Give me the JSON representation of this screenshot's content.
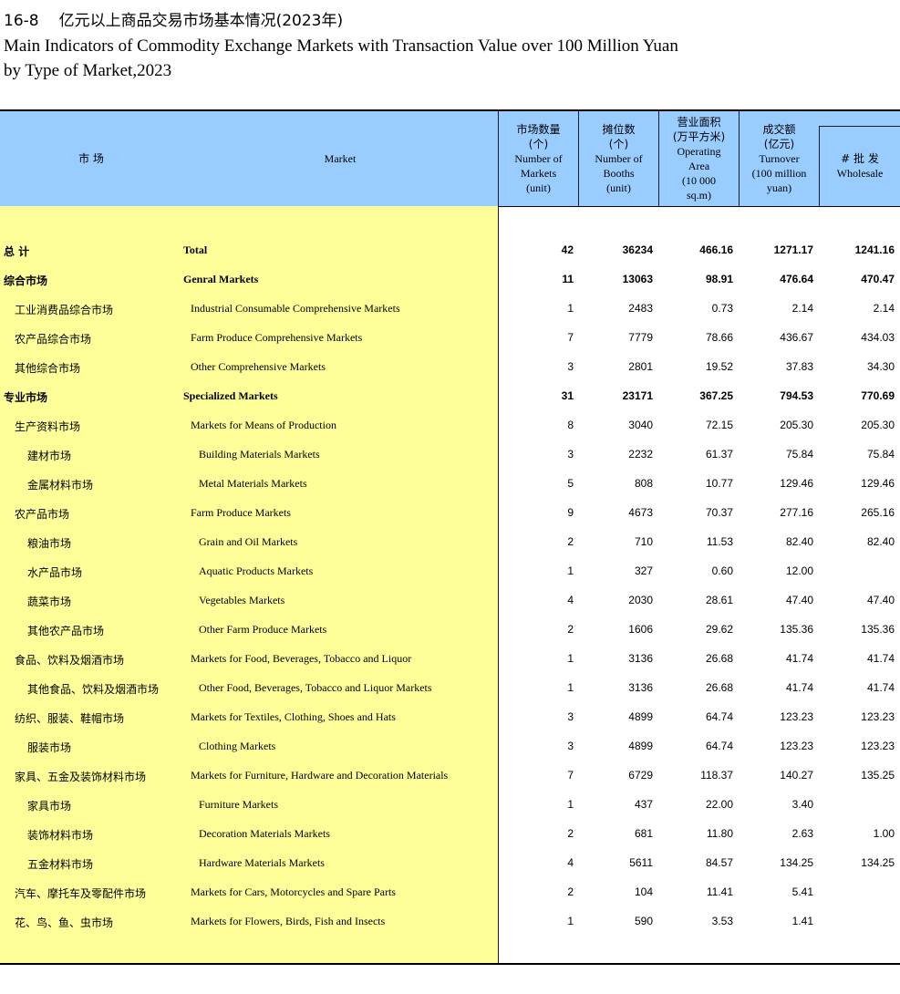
{
  "title": {
    "number": "16-8",
    "cn": "亿元以上商品交易市场基本情况(2023年)",
    "en_line1": "Main Indicators of Commodity Exchange Markets with Transaction Value over 100 Million Yuan",
    "en_line2": "by Type of Market,2023"
  },
  "header": {
    "market_cn": "市  场",
    "market_en": "Market",
    "col_markets": [
      "市场数量",
      "(个)",
      "Number of",
      "Markets",
      "(unit)"
    ],
    "col_booths": [
      "摊位数",
      "(个)",
      "Number of",
      "Booths",
      "(unit)"
    ],
    "col_area": [
      "营业面积",
      "(万平方米)",
      "Operating",
      "Area",
      "(10 000",
      "sq.m)"
    ],
    "col_turnover": [
      "成交额",
      "(亿元)",
      "Turnover",
      "(100 million",
      "yuan)"
    ],
    "col_wholesale": [
      "# 批  发",
      "Wholesale"
    ]
  },
  "rows": [
    {
      "cn": "总      计",
      "en": "Total",
      "markets": "42",
      "booths": "36234",
      "area": "466.16",
      "turnover": "1271.17",
      "wholesale": "1241.16",
      "level": 0
    },
    {
      "cn": "综合市场",
      "en": "Genral Markets",
      "markets": "11",
      "booths": "13063",
      "area": "98.91",
      "turnover": "476.64",
      "wholesale": "470.47",
      "level": 0
    },
    {
      "cn": "工业消费品综合市场",
      "en": "Industrial Consumable Comprehensive Markets",
      "markets": "1",
      "booths": "2483",
      "area": "0.73",
      "turnover": "2.14",
      "wholesale": "2.14",
      "level": 1
    },
    {
      "cn": "农产品综合市场",
      "en": "Farm Produce Comprehensive Markets",
      "markets": "7",
      "booths": "7779",
      "area": "78.66",
      "turnover": "436.67",
      "wholesale": "434.03",
      "level": 1
    },
    {
      "cn": "其他综合市场",
      "en": "Other Comprehensive Markets",
      "markets": "3",
      "booths": "2801",
      "area": "19.52",
      "turnover": "37.83",
      "wholesale": "34.30",
      "level": 1
    },
    {
      "cn": "专业市场",
      "en": "Specialized Markets",
      "markets": "31",
      "booths": "23171",
      "area": "367.25",
      "turnover": "794.53",
      "wholesale": "770.69",
      "level": 0
    },
    {
      "cn": "生产资料市场",
      "en": "Markets for Means of Production",
      "markets": "8",
      "booths": "3040",
      "area": "72.15",
      "turnover": "205.30",
      "wholesale": "205.30",
      "level": 1
    },
    {
      "cn": "建材市场",
      "en": "Building Materials Markets",
      "markets": "3",
      "booths": "2232",
      "area": "61.37",
      "turnover": "75.84",
      "wholesale": "75.84",
      "level": 2
    },
    {
      "cn": "金属材料市场",
      "en": "Metal Materials Markets",
      "markets": "5",
      "booths": "808",
      "area": "10.77",
      "turnover": "129.46",
      "wholesale": "129.46",
      "level": 2
    },
    {
      "cn": "农产品市场",
      "en": "Farm Produce Markets",
      "markets": "9",
      "booths": "4673",
      "area": "70.37",
      "turnover": "277.16",
      "wholesale": "265.16",
      "level": 1
    },
    {
      "cn": "粮油市场",
      "en": "Grain and Oil Markets",
      "markets": "2",
      "booths": "710",
      "area": "11.53",
      "turnover": "82.40",
      "wholesale": "82.40",
      "level": 2
    },
    {
      "cn": "水产品市场",
      "en": "Aquatic Products Markets",
      "markets": "1",
      "booths": "327",
      "area": "0.60",
      "turnover": "12.00",
      "wholesale": "",
      "level": 2
    },
    {
      "cn": "蔬菜市场",
      "en": "Vegetables Markets",
      "markets": "4",
      "booths": "2030",
      "area": "28.61",
      "turnover": "47.40",
      "wholesale": "47.40",
      "level": 2
    },
    {
      "cn": "其他农产品市场",
      "en": "Other Farm Produce Markets",
      "markets": "2",
      "booths": "1606",
      "area": "29.62",
      "turnover": "135.36",
      "wholesale": "135.36",
      "level": 2
    },
    {
      "cn": "食品、饮料及烟酒市场",
      "en": "Markets for Food, Beverages, Tobacco and Liquor",
      "markets": "1",
      "booths": "3136",
      "area": "26.68",
      "turnover": "41.74",
      "wholesale": "41.74",
      "level": 1
    },
    {
      "cn": "其他食品、饮料及烟酒市场",
      "en": "Other Food, Beverages, Tobacco and Liquor Markets",
      "markets": "1",
      "booths": "3136",
      "area": "26.68",
      "turnover": "41.74",
      "wholesale": "41.74",
      "level": 2
    },
    {
      "cn": "纺织、服装、鞋帽市场",
      "en": "Markets for Textiles, Clothing, Shoes and Hats",
      "markets": "3",
      "booths": "4899",
      "area": "64.74",
      "turnover": "123.23",
      "wholesale": "123.23",
      "level": 1
    },
    {
      "cn": "服装市场",
      "en": "Clothing Markets",
      "markets": "3",
      "booths": "4899",
      "area": "64.74",
      "turnover": "123.23",
      "wholesale": "123.23",
      "level": 2
    },
    {
      "cn": "家具、五金及装饰材料市场",
      "en": "Markets for Furniture, Hardware and Decoration Materials",
      "markets": "7",
      "booths": "6729",
      "area": "118.37",
      "turnover": "140.27",
      "wholesale": "135.25",
      "level": 1
    },
    {
      "cn": "家具市场",
      "en": "Furniture Markets",
      "markets": "1",
      "booths": "437",
      "area": "22.00",
      "turnover": "3.40",
      "wholesale": "",
      "level": 2
    },
    {
      "cn": "装饰材料市场",
      "en": "Decoration Materials Markets",
      "markets": "2",
      "booths": "681",
      "area": "11.80",
      "turnover": "2.63",
      "wholesale": "1.00",
      "level": 2
    },
    {
      "cn": "五金材料市场",
      "en": "Hardware Materials Markets",
      "markets": "4",
      "booths": "5611",
      "area": "84.57",
      "turnover": "134.25",
      "wholesale": "134.25",
      "level": 2
    },
    {
      "cn": "汽车、摩托车及零配件市场",
      "en": "Markets for Cars, Motorcycles and Spare Parts",
      "markets": "2",
      "booths": "104",
      "area": "11.41",
      "turnover": "5.41",
      "wholesale": "",
      "level": 1
    },
    {
      "cn": "花、鸟、鱼、虫市场",
      "en": "Markets for Flowers, Birds, Fish and Insects",
      "markets": "1",
      "booths": "590",
      "area": "3.53",
      "turnover": "1.41",
      "wholesale": "",
      "level": 1
    }
  ]
}
